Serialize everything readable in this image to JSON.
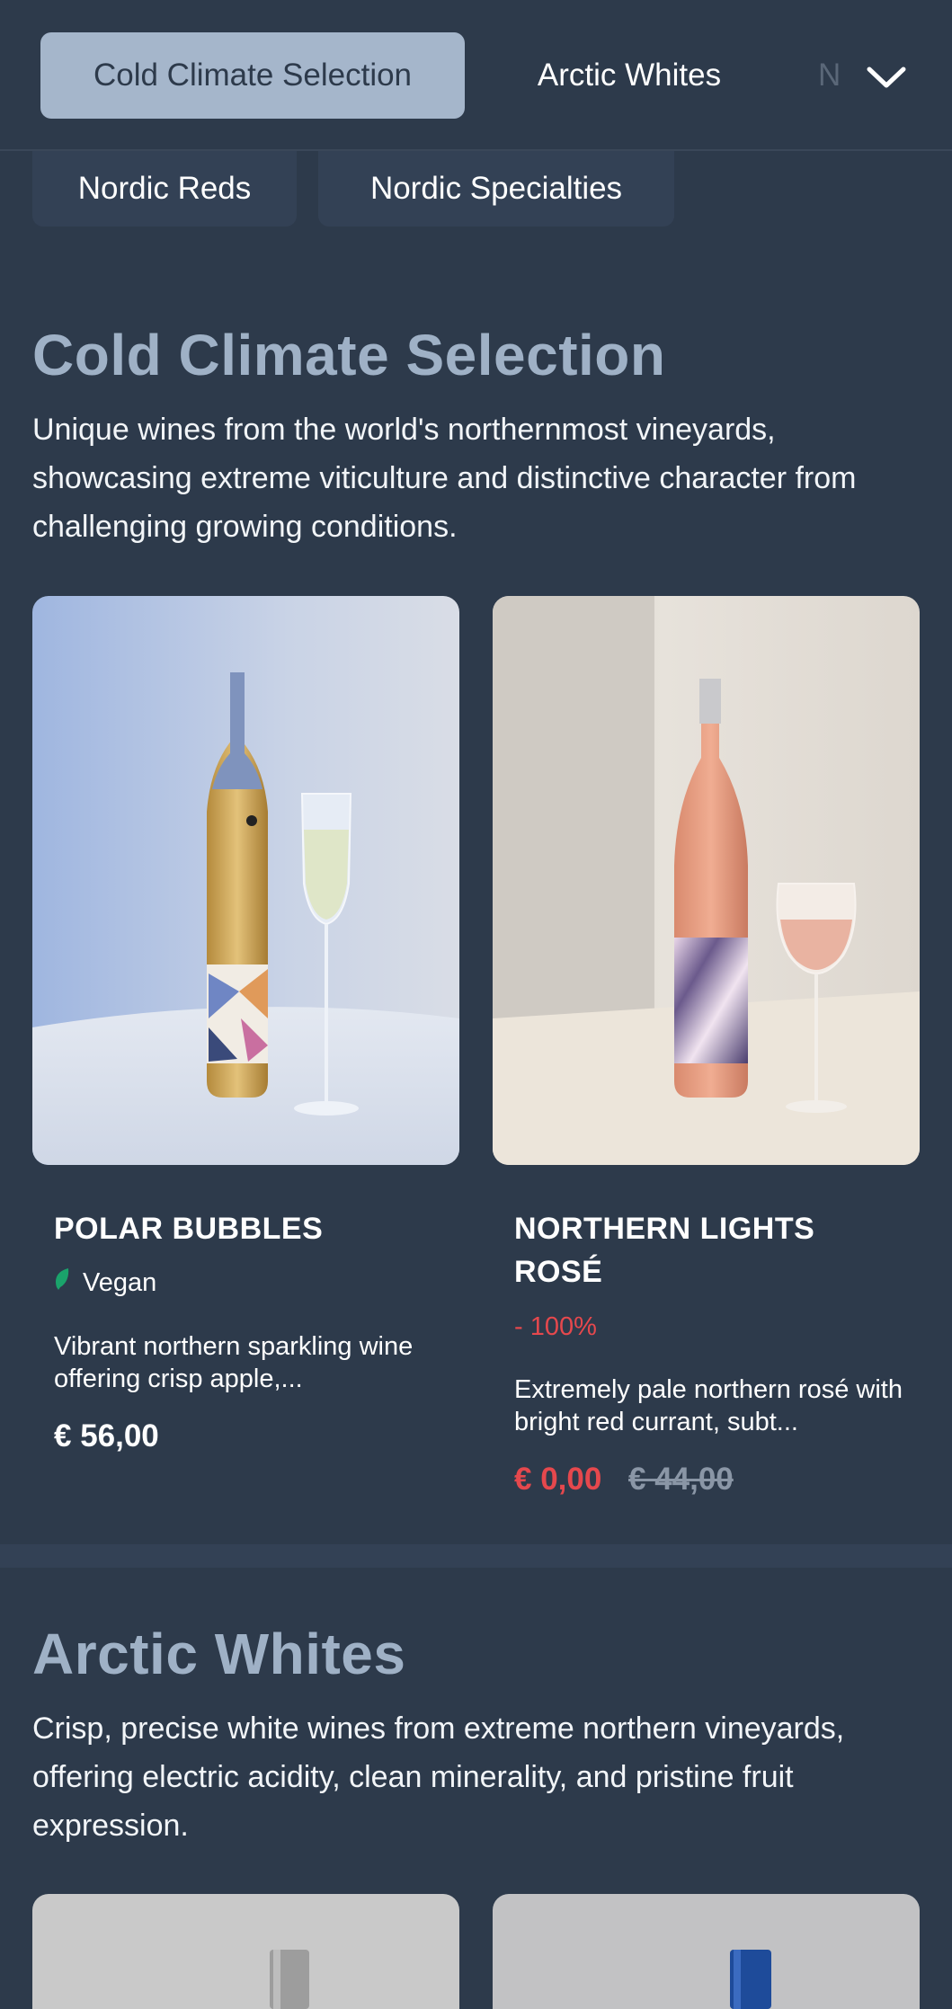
{
  "tabs": [
    {
      "label": "Cold Climate Selection",
      "active": true
    },
    {
      "label": "Arctic Whites",
      "active": false
    },
    {
      "label": "N",
      "active": false
    },
    {
      "label": "Nordic Reds",
      "active": false
    },
    {
      "label": "Nordic Specialties",
      "active": false
    }
  ],
  "expand_icon": "chevron-down-icon",
  "sections": [
    {
      "title": "Cold Climate Selection",
      "description": "Unique wines from the world's northernmost vineyards, showcasing extreme viticulture and distinctive character from challenging growing conditions.",
      "products": [
        {
          "name": "POLAR BUBBLES",
          "badge": "Vegan",
          "badge_icon": "leaf-icon",
          "description": "Vibrant northern sparkling wine offering crisp apple,...",
          "price": "€ 56,00"
        },
        {
          "name_line1": "NORTHERN LIGHTS",
          "name_line2": "ROSÉ",
          "discount": "- 100%",
          "description": "Extremely pale northern rosé with bright red currant, subt...",
          "price": "€ 0,00",
          "old_price": "€ 44,00"
        }
      ]
    },
    {
      "title": "Arctic Whites",
      "description": "Crisp, precise white wines from extreme northern vineyards, offering electric acidity, clean minerality, and pristine fruit expression."
    }
  ],
  "colors": {
    "background": "#2d3a4b",
    "active_tab": "#a5b6cb",
    "heading": "#9fb1c6",
    "sale": "#e5484d",
    "vegan": "#1aa36b"
  }
}
